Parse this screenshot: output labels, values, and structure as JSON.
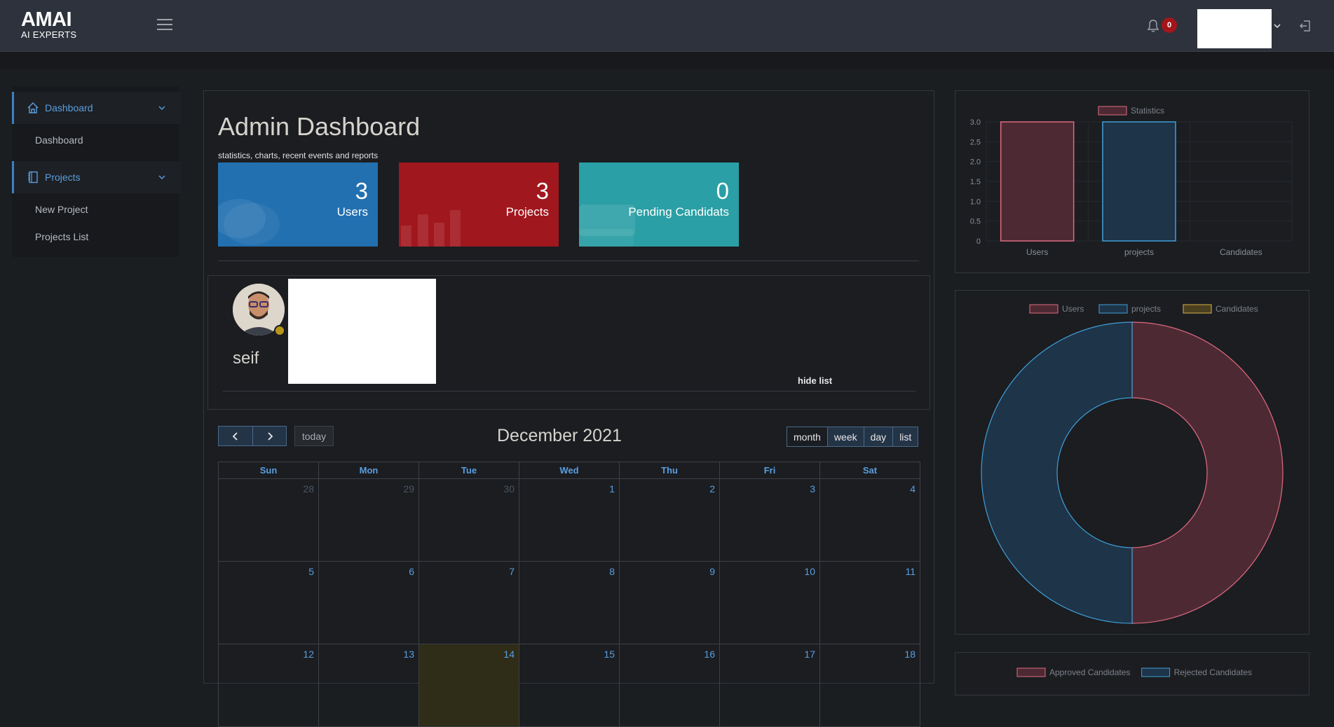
{
  "header": {
    "logo": "AMAI",
    "tagline": "AI EXPERTS",
    "notification_count": "0"
  },
  "sidebar": {
    "groups": [
      {
        "label": "Dashboard",
        "icon": "home-icon",
        "items": [
          "Dashboard"
        ]
      },
      {
        "label": "Projects",
        "icon": "notebook-icon",
        "items": [
          "New Project",
          "Projects List"
        ]
      }
    ]
  },
  "main": {
    "title": "Admin Dashboard",
    "subtitle": "statistics, charts, recent events and reports",
    "stats": [
      {
        "value": "3",
        "label": "Users",
        "color": "#2270b0"
      },
      {
        "value": "3",
        "label": "Projects",
        "color": "#a1171e"
      },
      {
        "value": "0",
        "label": "Pending Candidats",
        "color": "#2a9fa5"
      }
    ],
    "profile": {
      "name": "seif",
      "hide_list": "hide list"
    }
  },
  "calendar": {
    "title": "December 2021",
    "today_label": "today",
    "views": [
      "month",
      "week",
      "day",
      "list"
    ],
    "active_view": "month",
    "weekdays": [
      "Sun",
      "Mon",
      "Tue",
      "Wed",
      "Thu",
      "Fri",
      "Sat"
    ],
    "weeks": [
      [
        {
          "d": "28",
          "other": true
        },
        {
          "d": "29",
          "other": true
        },
        {
          "d": "30",
          "other": true
        },
        {
          "d": "1"
        },
        {
          "d": "2"
        },
        {
          "d": "3"
        },
        {
          "d": "4"
        }
      ],
      [
        {
          "d": "5"
        },
        {
          "d": "6"
        },
        {
          "d": "7"
        },
        {
          "d": "8"
        },
        {
          "d": "9"
        },
        {
          "d": "10"
        },
        {
          "d": "11"
        }
      ],
      [
        {
          "d": "12"
        },
        {
          "d": "13"
        },
        {
          "d": "14",
          "today": true
        },
        {
          "d": "15"
        },
        {
          "d": "16"
        },
        {
          "d": "17"
        },
        {
          "d": "18"
        }
      ]
    ]
  },
  "chart_data": [
    {
      "type": "bar",
      "legend": [
        "Statistics"
      ],
      "categories": [
        "Users",
        "projects",
        "Candidates"
      ],
      "values": [
        3,
        3,
        0
      ],
      "ylim": [
        0,
        3.0
      ],
      "yticks": [
        "3.0",
        "2.5",
        "2.0",
        "1.5",
        "1.0",
        "0.5",
        "0"
      ],
      "colors": {
        "fill": "#4d2a33",
        "stroke": "#e06a80",
        "fill2": "#1e3448",
        "stroke2": "#3f9fd8"
      }
    },
    {
      "type": "pie",
      "legend": [
        "Users",
        "projects",
        "Candidates"
      ],
      "values": [
        3,
        3,
        0
      ],
      "colors": [
        "#e06a80",
        "#3f9fd8",
        "#d8b34a"
      ]
    },
    {
      "type": "bar",
      "legend": [
        "Approved Candidates",
        "Rejected Candidates"
      ]
    }
  ]
}
